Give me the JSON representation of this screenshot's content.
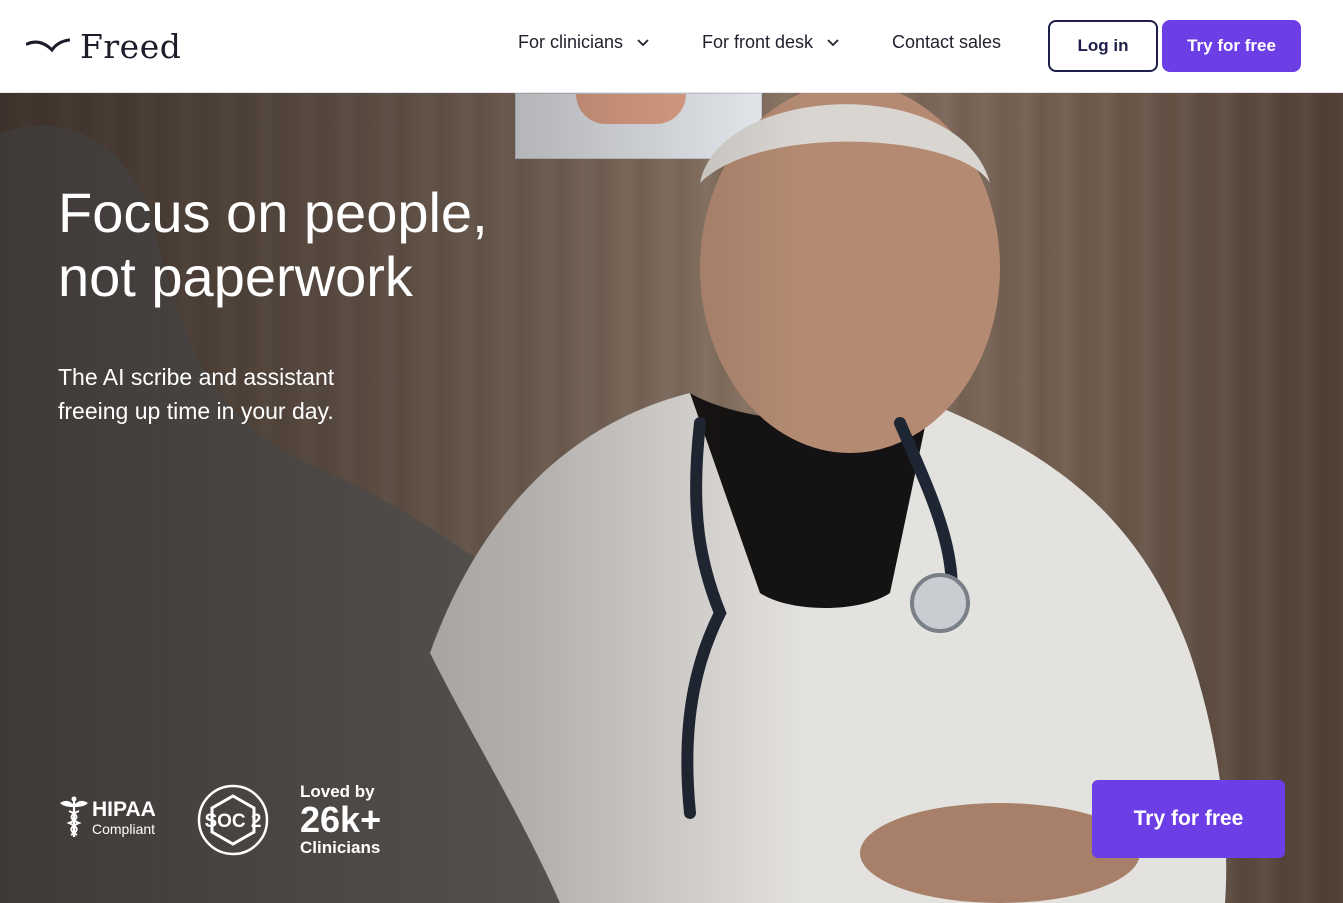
{
  "header": {
    "logo_text": "Freed",
    "nav": [
      {
        "label": "For clinicians",
        "has_dropdown": true
      },
      {
        "label": "For front desk",
        "has_dropdown": true
      },
      {
        "label": "Contact sales",
        "has_dropdown": false
      }
    ],
    "login_label": "Log in",
    "try_label": "Try for free"
  },
  "hero": {
    "headline_line1": "Focus on people,",
    "headline_line2": "not paperwork",
    "subheadline": "The AI scribe and assistant freeing up time in your day.",
    "cta_label": "Try for free",
    "badges": {
      "hipaa_title": "HIPAA",
      "hipaa_sub": "Compliant",
      "soc_label": "SOC 2",
      "loved_prefix": "Loved by",
      "loved_count": "26k+",
      "loved_suffix": "Clinicians"
    }
  },
  "colors": {
    "accent": "#6c3ee6",
    "navy": "#1d1f4a",
    "text_dark": "#22222e"
  },
  "icons": [
    "freed-logo-icon",
    "chevron-down-icon",
    "caduceus-icon",
    "soc2-badge-icon"
  ]
}
